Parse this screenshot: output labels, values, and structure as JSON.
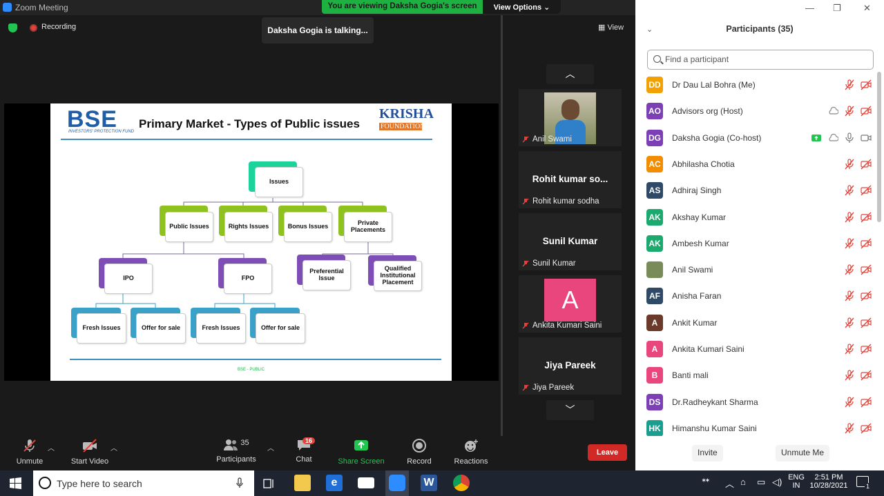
{
  "window": {
    "title": "Zoom Meeting",
    "viewing_banner": "You are viewing Daksha Gogia's screen",
    "view_options": "View Options"
  },
  "meeting": {
    "recording_label": "Recording",
    "talking_label": "Daksha Gogia is talking...",
    "view_label": "View"
  },
  "slide": {
    "logo_text": "BSE",
    "logo_subtitle": "INVESTORS' PROTECTION FUND",
    "heading": "Primary Market - Types of Public issues",
    "partner_logo_line1": "KRISHA",
    "partner_logo_line2": "FOUNDATION",
    "footer": "BSE - PUBLIC",
    "nodes": {
      "root": "Issues",
      "public": "Public Issues",
      "rights": "Rights Issues",
      "bonus": "Bonus Issues",
      "private": "Private Placements",
      "ipo": "IPO",
      "fpo": "FPO",
      "preferential": "Preferential Issue",
      "qip": "Qualified Institutional Placement",
      "ipo_fresh": "Fresh Issues",
      "ipo_ofs": "Offer for sale",
      "fpo_fresh": "Fresh Issues",
      "fpo_ofs": "Offer for sale"
    }
  },
  "video_tiles": [
    {
      "name": "Anil Swami",
      "type": "photo"
    },
    {
      "name": "Rohit kumar sodha",
      "big": "Rohit kumar so..."
    },
    {
      "name": "Sunil Kumar",
      "big": "Sunil Kumar"
    },
    {
      "name": "Ankita Kumari Saini",
      "avatar_letter": "A",
      "avatar_color": "#e8467c"
    },
    {
      "name": "Jiya Pareek",
      "big": "Jiya Pareek"
    }
  ],
  "toolbar": {
    "unmute": "Unmute",
    "start_video": "Start Video",
    "participants": "Participants",
    "participants_count": "35",
    "chat": "Chat",
    "chat_badge": "16",
    "share_screen": "Share Screen",
    "record": "Record",
    "reactions": "Reactions",
    "leave": "Leave"
  },
  "panel": {
    "title": "Participants (35)",
    "search_placeholder": "Find a participant",
    "invite": "Invite",
    "unmute_me": "Unmute Me",
    "participants": [
      {
        "initials": "DD",
        "name": "Dr Dau Lal Bohra (Me)",
        "color": "#f2a100"
      },
      {
        "initials": "AO",
        "name": "Advisors org (Host)",
        "color": "#7c3fb5"
      },
      {
        "initials": "DG",
        "name": "Daksha Gogia (Co-host)",
        "color": "#7c3fb5"
      },
      {
        "initials": "AC",
        "name": "Abhilasha Chotia",
        "color": "#f28c00"
      },
      {
        "initials": "AS",
        "name": "Adhiraj Singh",
        "color": "#2e4a66"
      },
      {
        "initials": "AK",
        "name": "Akshay Kumar",
        "color": "#1aaa6e"
      },
      {
        "initials": "AK",
        "name": "Ambesh Kumar",
        "color": "#1aaa6e"
      },
      {
        "initials": "",
        "name": "Anil Swami",
        "color": "#7a8b5a"
      },
      {
        "initials": "AF",
        "name": "Anisha Faran",
        "color": "#2e4a66"
      },
      {
        "initials": "A",
        "name": "Ankit Kumar",
        "color": "#6b3a2a"
      },
      {
        "initials": "A",
        "name": "Ankita Kumari Saini",
        "color": "#e8467c"
      },
      {
        "initials": "B",
        "name": "Banti mali",
        "color": "#e8467c"
      },
      {
        "initials": "DS",
        "name": "Dr.Radheykant Sharma",
        "color": "#7c3fb5"
      },
      {
        "initials": "HK",
        "name": "Himanshu Kumar Saini",
        "color": "#1a9e8f"
      }
    ]
  },
  "taskbar": {
    "search_placeholder": "Type here to search",
    "lang1": "ENG",
    "lang2": "IN",
    "time": "2:51 PM",
    "date": "10/28/2021",
    "notifications": "1"
  }
}
